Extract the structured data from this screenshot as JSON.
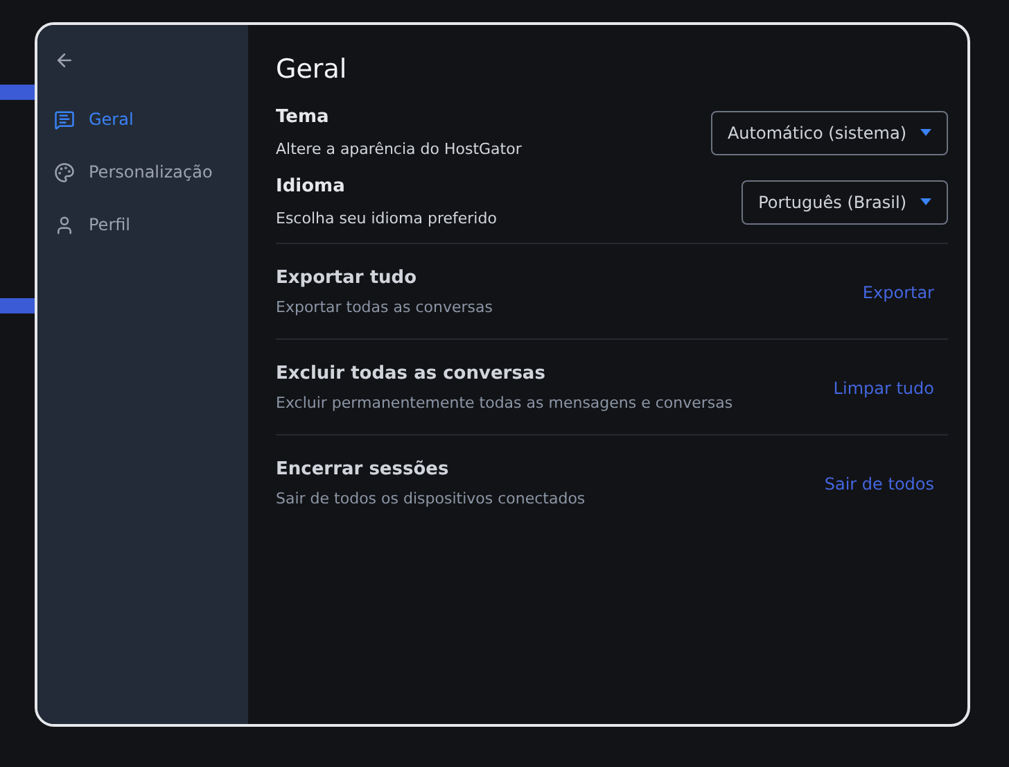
{
  "sidebar": {
    "items": [
      {
        "label": "Geral",
        "kind": "chat",
        "selected": true
      },
      {
        "label": "Personalização",
        "kind": "palette",
        "selected": false
      },
      {
        "label": "Perfil",
        "kind": "user",
        "selected": false
      }
    ]
  },
  "title": "Geral",
  "selects": [
    {
      "label": "Tema",
      "description": "Altere a aparência do HostGator",
      "value": "Automático (sistema)"
    },
    {
      "label": "Idioma",
      "description": "Escolha seu idioma preferido",
      "value": "Português (Brasil)"
    }
  ],
  "actions": [
    {
      "label": "Exportar tudo",
      "description": "Exportar todas as conversas",
      "button": "Exportar"
    },
    {
      "label": "Excluir todas as conversas",
      "description": "Excluir permanentemente todas as mensagens e conversas",
      "button": "Limpar tudo"
    },
    {
      "label": "Encerrar sessões",
      "description": "Sair de todos os dispositivos conectados",
      "button": "Sair de todos"
    }
  ]
}
